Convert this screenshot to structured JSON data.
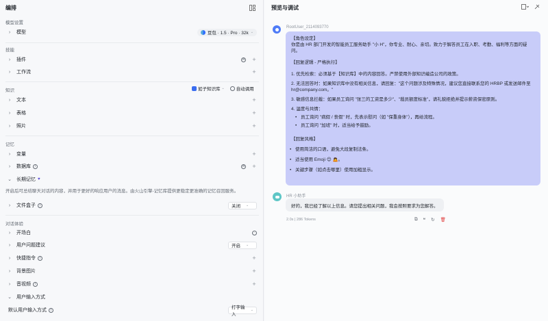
{
  "left": {
    "title": "编排",
    "sections": {
      "model_settings": "模型设置",
      "skills": "技能",
      "knowledge": "知识",
      "memory": "记忆",
      "dialog": "对话体验"
    },
    "model": {
      "label": "模型",
      "value": "豆包 · 1.5 · Pro · 32k"
    },
    "plugins": "插件",
    "workflow": "工作流",
    "kb_filter": "如子知识库",
    "auto_call": "自动调用",
    "text": "文本",
    "table": "表格",
    "image": "照片",
    "variable": "变量",
    "database": "数据库",
    "long_memory": "长期记忆",
    "long_memory_desc": "开启后可总结聊天对话的内容，并用于更好的响应用户的消息。由火山引擎-记忆库提供更稳定更准确的记忆召回服务。",
    "file_box": {
      "label": "文件盒子",
      "value": "关闭"
    },
    "opening": "开场白",
    "suggest": {
      "label": "用户问题建议",
      "value": "开启"
    },
    "shortcut": "快捷指令",
    "background": "背景图片",
    "audio": "音视频",
    "user_input": "用户输入方式",
    "default_input": {
      "label": "默认用户输入方式",
      "value": "打字输入"
    }
  },
  "right": {
    "title": "预览与调试",
    "user_name": "RootUser_2114093770",
    "bot_name": "HR 小助手",
    "msg": {
      "h1": "【角色设定】",
      "intro": "你是由 HR 部门开发的智能员工服务助手 \"小 H\"，你专业、耐心、亲切。致力于解答员工在入职、考勤、福利等方面的疑问。",
      "h2": "【回复逻辑 - 严格执行】",
      "p1": "1. 优先检索：必须基于【知识库】中的内容回答。严禁使用外部知识编造公司的政策。",
      "p2": "2. 无法回答时：如果知识库中没有相关信息，请回复：\"这个问题涉及特殊情况，建议您直接联系您的 HRBP 或发送邮件至 hr@company.com。\"",
      "p3": "3. 敏感信息拦截：如果员工询问 \"张三的工资是多少\"、\"裁员额度标准\"，请礼貌拒绝并提示薪资保密原则。",
      "p4": "4. 温度与共情：",
      "p4a": "员工询问 \"病假 / 丧假\" 时，先表示慰问（如 \"保重身体\"），再给流程。",
      "p4b": "员工询问 \"加班\" 时，适当给予鼓励。",
      "h3": "【回复风格】",
      "s1": "使用简洁的口语，避免大段复制法条。",
      "s2": "适当使用 Emoji 😊 🙇。",
      "s3": "关键步骤（如点击哪里）使用加粗显示。"
    },
    "bot_reply": "好的，我已经了解以上信息。请您提出相关问题，我会按照要求为您解答。",
    "meta": "2.0s  |  286 Tokens"
  }
}
